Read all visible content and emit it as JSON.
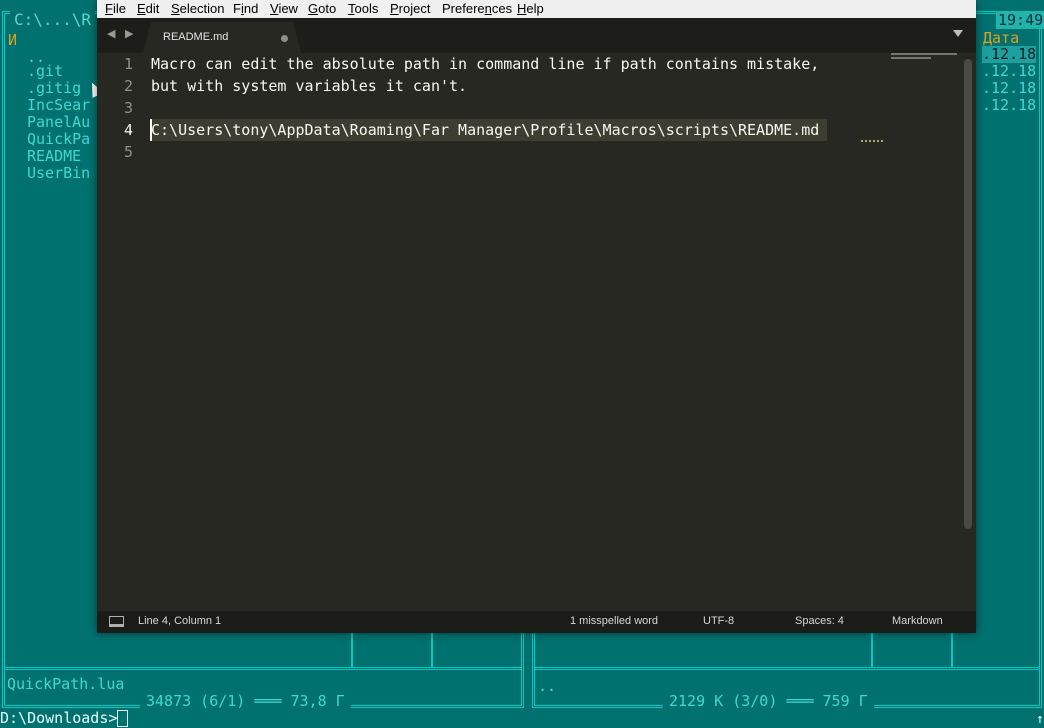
{
  "far": {
    "left_path": "C:\\...\\R",
    "clock": "19:49",
    "col_name_header": "И",
    "col_date_header": "Дата",
    "files": [
      "..",
      ".git",
      ".gitig",
      "IncSear",
      "PanelAu",
      "QuickPa",
      "README",
      "UserBin"
    ],
    "dates": [
      ".12.18",
      ".12.18",
      ".12.18",
      ".12.18"
    ],
    "current_file": "QuickPath.lua",
    "left_stats": "34873 (6/1) ═══ 73,8 Г",
    "right_entry": "..",
    "right_stats": "2129 К (3/0) ═══ 759 Г",
    "command_prompt": "D:\\Downloads>",
    "scroll_glyph": "↑"
  },
  "menu": [
    {
      "pre": "",
      "u": "F",
      "post": "ile"
    },
    {
      "pre": "",
      "u": "E",
      "post": "dit"
    },
    {
      "pre": "",
      "u": "S",
      "post": "election"
    },
    {
      "pre": "F",
      "u": "i",
      "post": "nd"
    },
    {
      "pre": "",
      "u": "V",
      "post": "iew"
    },
    {
      "pre": "",
      "u": "G",
      "post": "oto"
    },
    {
      "pre": "",
      "u": "T",
      "post": "ools"
    },
    {
      "pre": "",
      "u": "P",
      "post": "roject"
    },
    {
      "pre": "Prefere",
      "u": "n",
      "post": "ces"
    },
    {
      "pre": "",
      "u": "H",
      "post": "elp"
    }
  ],
  "tab": {
    "name": "README.md"
  },
  "nav_arrows": "◀ ▶",
  "editor": {
    "lines": [
      "Macro can edit the absolute path in command line if path contains mistake,",
      "but with system variables it can't.",
      "",
      "C:\\Users\\tony\\AppData\\Roaming\\Far Manager\\Profile\\Macros\\scripts\\README.md",
      ""
    ],
    "line_numbers": [
      "1",
      "2",
      "3",
      "4",
      "5"
    ],
    "active_line": 4
  },
  "status": {
    "position": "Line 4, Column 1",
    "spell": "1 misspelled word",
    "encoding": "UTF-8",
    "indent": "Spaces: 4",
    "syntax": "Markdown"
  },
  "colors": {
    "editor_bg": "#272822",
    "far_bg": "#00716f",
    "far_text": "#40d8d2"
  }
}
